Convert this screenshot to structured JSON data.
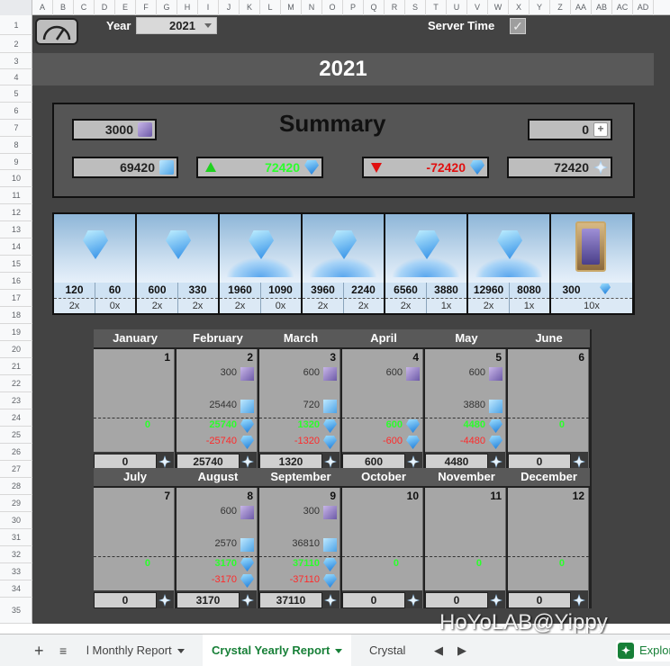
{
  "columns": [
    "A",
    "B",
    "C",
    "D",
    "E",
    "F",
    "G",
    "H",
    "I",
    "J",
    "K",
    "L",
    "M",
    "N",
    "O",
    "P",
    "Q",
    "R",
    "S",
    "T",
    "U",
    "V",
    "W",
    "X",
    "Y",
    "Z",
    "AA",
    "AB",
    "AC",
    "AD"
  ],
  "rows": [
    "1",
    "2",
    "3",
    "4",
    "5",
    "6",
    "7",
    "8",
    "9",
    "10",
    "11",
    "12",
    "13",
    "14",
    "15",
    "16",
    "17",
    "18",
    "19",
    "20",
    "21",
    "22",
    "23",
    "24",
    "25",
    "26",
    "27",
    "28",
    "29",
    "30",
    "31",
    "32",
    "33",
    "34",
    "35"
  ],
  "controls": {
    "year_label": "Year",
    "year_value": "2021",
    "server_time_label": "Server Time",
    "server_time_checked": "✓"
  },
  "title": "2021",
  "summary": {
    "title": "Summary",
    "fates": "3000",
    "extra": "0",
    "crystals": "69420",
    "gained": "72420",
    "spent": "-72420",
    "total": "72420"
  },
  "packs": [
    {
      "a": "120",
      "b": "60",
      "ma": "2x",
      "mb": "0x",
      "kind": "gem"
    },
    {
      "a": "600",
      "b": "330",
      "ma": "2x",
      "mb": "2x",
      "kind": "gem"
    },
    {
      "a": "1960",
      "b": "1090",
      "ma": "2x",
      "mb": "0x",
      "kind": "pile"
    },
    {
      "a": "3960",
      "b": "2240",
      "ma": "2x",
      "mb": "2x",
      "kind": "pile"
    },
    {
      "a": "6560",
      "b": "3880",
      "ma": "2x",
      "mb": "1x",
      "kind": "pile"
    },
    {
      "a": "12960",
      "b": "8080",
      "ma": "2x",
      "mb": "1x",
      "kind": "pile"
    },
    {
      "a": "300",
      "b": "",
      "ma": "10x",
      "mb": "",
      "kind": "card"
    }
  ],
  "months_top": [
    {
      "name": "January",
      "day": "1",
      "fate": "",
      "crystal": "",
      "gain": "0",
      "spend": "",
      "total": "0"
    },
    {
      "name": "February",
      "day": "2",
      "fate": "300",
      "crystal": "25440",
      "gain": "25740",
      "spend": "-25740",
      "total": "25740"
    },
    {
      "name": "March",
      "day": "3",
      "fate": "600",
      "crystal": "720",
      "gain": "1320",
      "spend": "-1320",
      "total": "1320"
    },
    {
      "name": "April",
      "day": "4",
      "fate": "600",
      "crystal": "",
      "gain": "600",
      "spend": "-600",
      "total": "600"
    },
    {
      "name": "May",
      "day": "5",
      "fate": "600",
      "crystal": "3880",
      "gain": "4480",
      "spend": "-4480",
      "total": "4480"
    },
    {
      "name": "June",
      "day": "6",
      "fate": "",
      "crystal": "",
      "gain": "0",
      "spend": "",
      "total": "0"
    }
  ],
  "months_bottom": [
    {
      "name": "July",
      "day": "7",
      "fate": "",
      "crystal": "",
      "gain": "0",
      "spend": "",
      "total": "0"
    },
    {
      "name": "August",
      "day": "8",
      "fate": "600",
      "crystal": "2570",
      "gain": "3170",
      "spend": "-3170",
      "total": "3170"
    },
    {
      "name": "September",
      "day": "9",
      "fate": "300",
      "crystal": "36810",
      "gain": "37110",
      "spend": "-37110",
      "total": "37110"
    },
    {
      "name": "October",
      "day": "10",
      "fate": "",
      "crystal": "",
      "gain": "0",
      "spend": "",
      "total": "0"
    },
    {
      "name": "November",
      "day": "11",
      "fate": "",
      "crystal": "",
      "gain": "0",
      "spend": "",
      "total": "0"
    },
    {
      "name": "December",
      "day": "12",
      "fate": "",
      "crystal": "",
      "gain": "0",
      "spend": "",
      "total": "0"
    }
  ],
  "watermark": "HoYoLAB@Yippy",
  "tabs": {
    "add": "+",
    "all": "≡",
    "prev_partial": "l Monthly Report",
    "active": "Crystal Yearly Report",
    "next_partial": "Crystal Lo",
    "nav_left": "◀",
    "nav_right": "▶",
    "explore": "Explore",
    "explore_icon": "✦"
  },
  "colors": {
    "sheet_bg": "#434343",
    "gain_green": "#2bff2b",
    "spend_red": "#ff2a2a",
    "tab_active": "#188038"
  }
}
